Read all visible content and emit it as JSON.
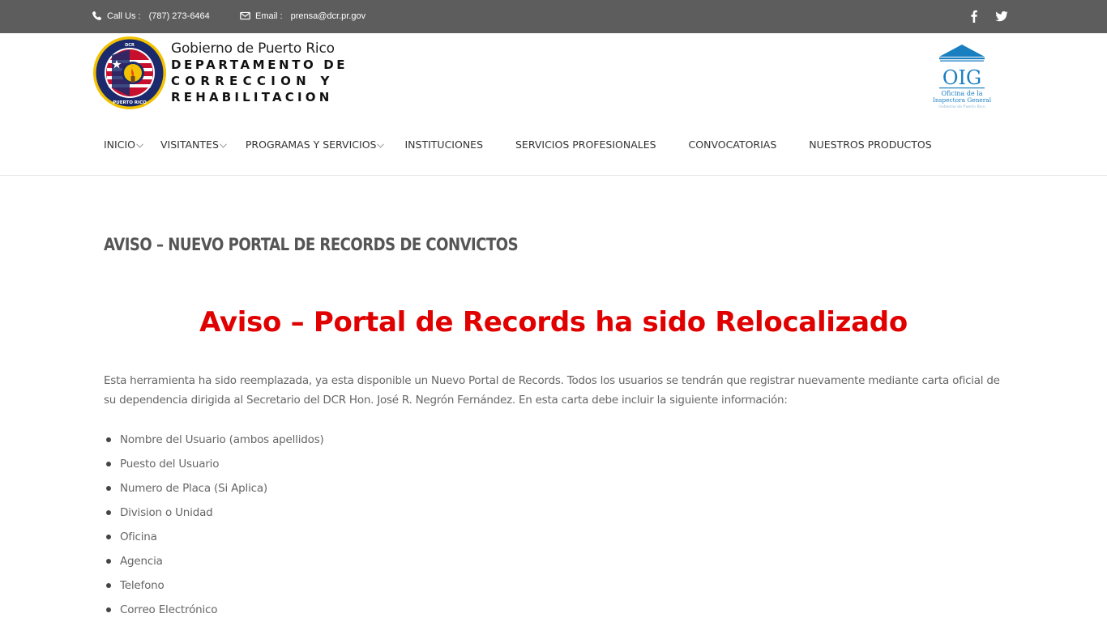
{
  "topbar": {
    "phone_label": "Call Us :",
    "phone_value": "(787) 273-6464",
    "email_label": "Email :",
    "email_value": "prensa@dcr.pr.gov",
    "icons": [
      "phone-icon",
      "envelope-icon",
      "facebook-icon",
      "twitter-icon"
    ]
  },
  "brand": {
    "line1": "Gobierno de Puerto Rico",
    "line2": "DEPARTAMENTO DE",
    "line3": "CORRECCION Y",
    "line4": "REHABILITACION",
    "seal_text_top": "DEPARTAMENTO DE CORRECCION Y REHABILITACION",
    "seal_text_bottom": "PUERTO RICO",
    "oig_text": "OIG",
    "oig_sub1": "Oficina de la",
    "oig_sub2": "Inspectora General",
    "oig_sub3": "Gobierno de Puerto Rico"
  },
  "nav": {
    "items": [
      {
        "label": "INICIO",
        "has_dropdown": true
      },
      {
        "label": "VISITANTES",
        "has_dropdown": true
      },
      {
        "label": "PROGRAMAS Y SERVICIOS",
        "has_dropdown": true
      },
      {
        "label": "INSTITUCIONES",
        "has_dropdown": false
      },
      {
        "label": "SERVICIOS PROFESIONALES",
        "has_dropdown": false
      },
      {
        "label": "CONVOCATORIAS",
        "has_dropdown": false
      },
      {
        "label": "NUESTROS PRODUCTOS",
        "has_dropdown": false
      }
    ]
  },
  "page": {
    "title": "AVISO – NUEVO PORTAL DE RECORDS DE CONVICTOS",
    "headline": "Aviso – Portal de Records ha sido Relocalizado",
    "intro": "Esta herramienta ha sido reemplazada, ya esta disponible un Nuevo Portal de Records. Todos los usuarios se tendrán que registrar nuevamente mediante carta oficial de su dependencia dirigida al Secretario del DCR Hon. José R. Negrón Fernández. En esta carta debe incluir la siguiente información:",
    "bullets": [
      "Nombre del Usuario (ambos apellidos)",
      "Puesto del Usuario",
      "Numero de Placa (Si Aplica)",
      "Division o Unidad",
      "Oficina",
      "Agencia",
      "Telefono",
      "Correo Electrónico"
    ]
  },
  "colors": {
    "topbar_bg": "#5d5d5d",
    "headline_red": "#e00000",
    "oig_blue": "#1a7fc1"
  }
}
